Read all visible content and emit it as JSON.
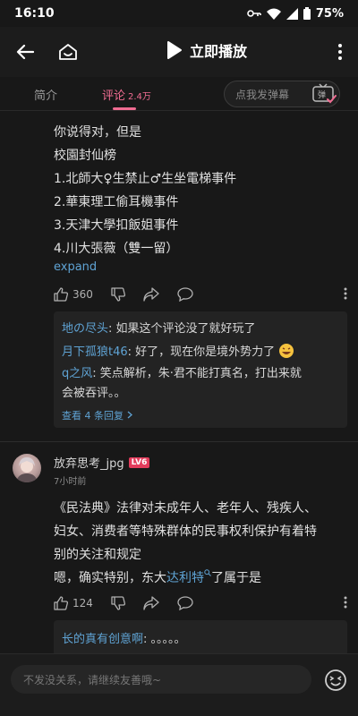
{
  "status_bar": {
    "time": "16:10",
    "battery": "75%"
  },
  "top_bar": {
    "play_label": "立即播放"
  },
  "tabs": {
    "intro": "简介",
    "comments": "评论",
    "comments_count": "2.4万"
  },
  "danmaku": {
    "placeholder": "点我发弹幕",
    "button_icon": "弹"
  },
  "comment1": {
    "lines": [
      "你说得对，但是",
      "校園封仙榜",
      "1.北師大♀生禁止♂生坐電梯事件",
      "2.華東理工偷耳機事件",
      "3.天津大學扣飯姐事件",
      "4.川大張薇（雙一留）"
    ],
    "expand": "expand",
    "likes": "360",
    "replies": [
      {
        "user": "地の尽头",
        "text": "如果这个评论没了就好玩了"
      },
      {
        "user": "月下孤狼t46",
        "text": "好了，现在你是境外势力了"
      },
      {
        "user": "q之风",
        "text": "笑点解析，朱·君不能打真名，打出来就"
      },
      {
        "user": "",
        "text": "会被吞评。。"
      }
    ],
    "view_more": "查看 4 条回复"
  },
  "comment2": {
    "username": "放弃思考_jpg",
    "level": "LV6",
    "time": "7小时前",
    "lines": [
      "《民法典》法律对未成年人、老年人、残疾人、",
      "妇女、消费者等特殊群体的民事权利保护有着特",
      "别的关注和规定"
    ],
    "last_prefix": "嗯，确实特别，东大",
    "last_link": "达利特",
    "last_suffix": "了属于是",
    "likes": "124",
    "reply": {
      "user": "长的真有创意啊",
      "text": "。。。。。"
    }
  },
  "bottom_bar": {
    "placeholder": "不发没关系，请继续友善哦~"
  },
  "colors": {
    "accent": "#f06c92",
    "link": "#5fa3d4",
    "background": "#181818"
  }
}
